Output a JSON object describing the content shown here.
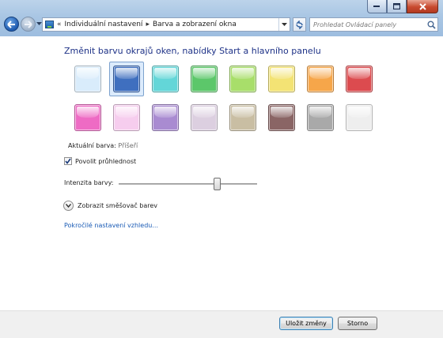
{
  "window": {
    "minimize_icon": "minimize-icon",
    "maximize_icon": "maximize-icon",
    "close_icon": "close-icon"
  },
  "nav": {
    "back_icon": "back-arrow-icon",
    "forward_icon": "forward-arrow-icon",
    "dropdown_icon": "chevron-down-icon"
  },
  "address": {
    "overflow": "«",
    "crumbs": [
      "Individuální nastavení",
      "Barva a zobrazení okna"
    ],
    "separator": "▸"
  },
  "search": {
    "placeholder": "Prohledat Ovládací panely"
  },
  "main": {
    "heading": "Změnit barvu okrajů oken, nabídky Start a hlavního panelu",
    "current_color_label": "Aktuální barva:",
    "current_color_value": "Příšeří",
    "transparency_label": "Povolit průhlednost",
    "transparency_checked": true,
    "intensity_label": "Intenzita barvy:",
    "intensity_value": 0.72,
    "mixer_label": "Zobrazit směšovač barev",
    "advanced_link": "Pokročilé nastavení vzhledu..."
  },
  "swatches": [
    {
      "color": "#d9ecfb",
      "selected": false
    },
    {
      "color": "#3f6fbf",
      "selected": true
    },
    {
      "color": "#63d6d8",
      "selected": false
    },
    {
      "color": "#5cc76a",
      "selected": false
    },
    {
      "color": "#a8de6a",
      "selected": false
    },
    {
      "color": "#f3e374",
      "selected": false
    },
    {
      "color": "#f6a64a",
      "selected": false
    },
    {
      "color": "#dc4b4f",
      "selected": false
    },
    {
      "color": "#ee6bc4",
      "selected": false
    },
    {
      "color": "#f6cdee",
      "selected": false
    },
    {
      "color": "#a98bd1",
      "selected": false
    },
    {
      "color": "#dccfe0",
      "selected": false
    },
    {
      "color": "#c9bea3",
      "selected": false
    },
    {
      "color": "#8a6565",
      "selected": false
    },
    {
      "color": "#a9a9a9",
      "selected": false
    },
    {
      "color": "#eeeeee",
      "selected": false
    }
  ],
  "footer": {
    "save": "Uložit změny",
    "cancel": "Storno"
  }
}
